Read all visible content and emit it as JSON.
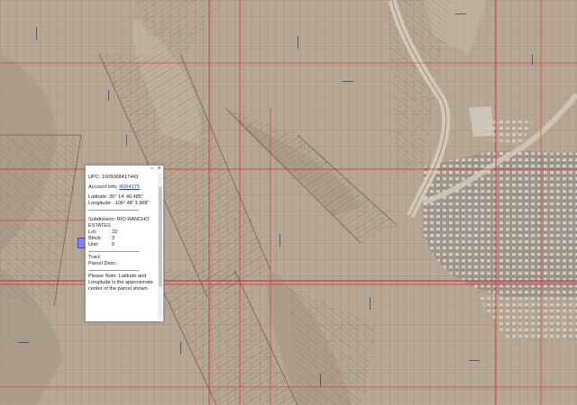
{
  "map": {
    "colors": {
      "ground": "#b9a996",
      "ground_dark": "#a59584",
      "ground_light": "#cfc0ad",
      "parcel_lines": "#5a4a3d",
      "roads_red": "#d03c3c",
      "road_paved": "#d6cbbb",
      "marker": "#7c7cff"
    }
  },
  "popup": {
    "minimize_icon": "minimize-icon",
    "close_icon": "close-icon",
    "upc_label": "UPC:",
    "upc_value": "1005068417443",
    "account_label": "Account Info:",
    "account_value": "R064175",
    "latitude_label": "Latitude:",
    "latitude_value": "35° 14' 46.485\"",
    "longitude_label": "Longitude:",
    "longitude_value": "-106° 48' 3.968\"",
    "subdivision_label": "Subdivision:",
    "subdivision_value": "RIO RANCHO ESTATES",
    "lot_label": "Lot:",
    "lot_value": "22",
    "block_label": "Block:",
    "block_value": "3",
    "unit_label": "Unit:",
    "unit_value": "5",
    "tract_label": "Tract:",
    "parcel_desc_label": "Parcel Desc.:",
    "note": "Please Note: Latitude and Longitude is the approximate center of the parcel shown."
  }
}
